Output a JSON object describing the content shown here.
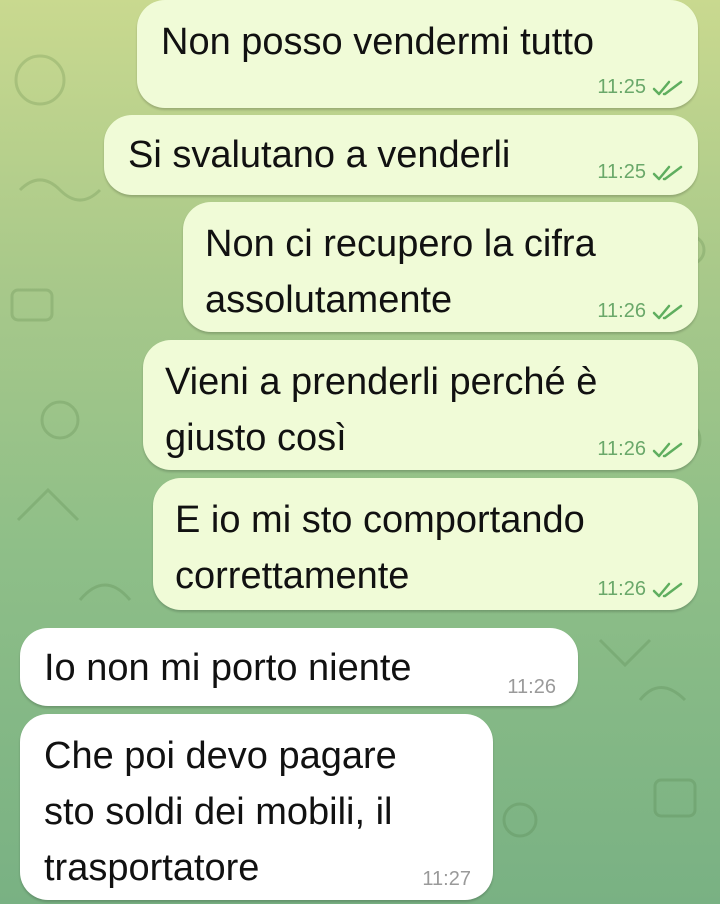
{
  "messages": [
    {
      "direction": "out",
      "text": "Non posso vendermi tutto",
      "time": "11:25",
      "status_icon": "double-check-icon"
    },
    {
      "direction": "out",
      "text": "Si svalutano a venderli",
      "time": "11:25",
      "status_icon": "double-check-icon"
    },
    {
      "direction": "out",
      "text": "Non ci recupero la cifra\nassolutamente",
      "time": "11:26",
      "status_icon": "double-check-icon"
    },
    {
      "direction": "out",
      "text": "Vieni a prenderli perché è\ngiusto così",
      "time": "11:26",
      "status_icon": "double-check-icon"
    },
    {
      "direction": "out",
      "text": "E io mi sto comportando\ncorrettamente",
      "time": "11:26",
      "status_icon": "double-check-icon"
    },
    {
      "direction": "in",
      "text": "Io non mi porto niente",
      "time": "11:26"
    },
    {
      "direction": "in",
      "text": "Che poi devo pagare\nsto soldi dei mobili, il\ntrasportatore",
      "time": "11:27"
    }
  ],
  "colors": {
    "outgoing_bubble": "#f0fbd7",
    "incoming_bubble": "#ffffff",
    "read_check": "#5fae5f"
  }
}
